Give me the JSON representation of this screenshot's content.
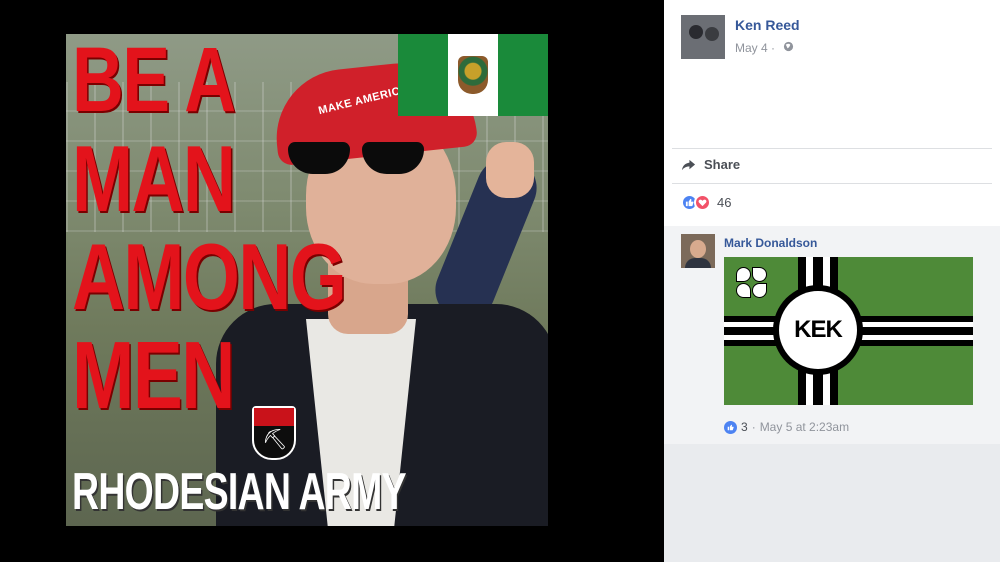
{
  "photo": {
    "cap_text": "MAKE AMERICA GREAT AGAIN",
    "slogan_lines": [
      "BE A",
      "MAN",
      "AMONG",
      "MEN"
    ],
    "bottom_text": "RHODESIAN ARMY"
  },
  "post": {
    "author": "Ken Reed",
    "date": "May 4",
    "date_sep": " · ",
    "share_label": "Share",
    "reaction_count": "46",
    "colors": {
      "link": "#365899",
      "like": "#4d83f2",
      "love": "#f25268",
      "slogan_red": "#e3131b"
    }
  },
  "comment": {
    "author": "Mark Donaldson",
    "flag_text": "KEK",
    "like_count": "3",
    "meta_sep": "·",
    "timestamp": "May 5 at 2:23am"
  }
}
